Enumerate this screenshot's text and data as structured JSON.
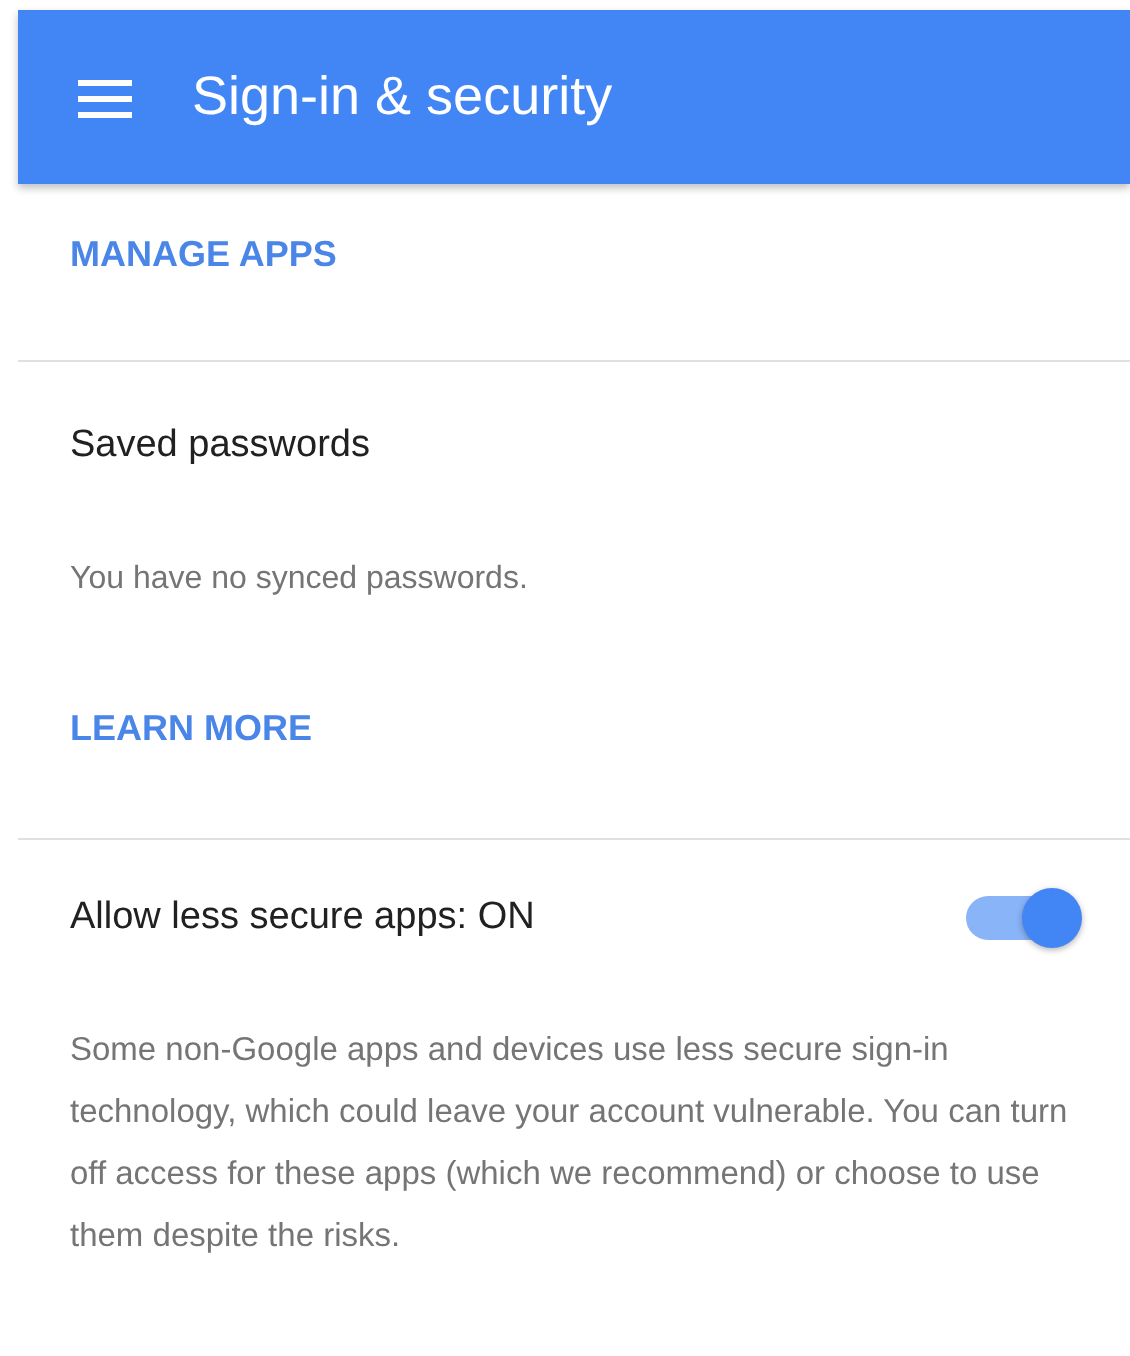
{
  "header": {
    "title": "Sign-in & security"
  },
  "sections": [
    {
      "kind": "link",
      "link": "MANAGE APPS"
    },
    {
      "kind": "info",
      "title": "Saved passwords",
      "text": "You have no synced passwords.",
      "link": "LEARN MORE"
    },
    {
      "kind": "toggle",
      "title": "Allow less secure apps: ON",
      "on": true,
      "text": "Some non-Google apps and devices use less secure sign-in technology, which could leave your account vulnerable. You can turn off access for these apps (which we recommend) or choose to use them despite the risks."
    }
  ]
}
